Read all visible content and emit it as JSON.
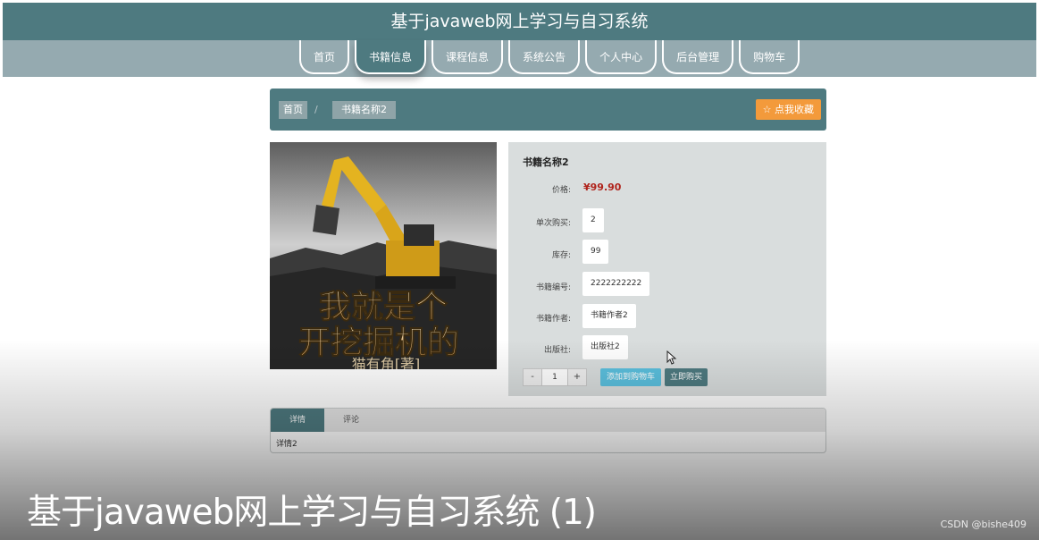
{
  "site_title": "基于javaweb网上学习与自习系统",
  "nav": {
    "items": [
      "首页",
      "书籍信息",
      "课程信息",
      "系统公告",
      "个人中心",
      "后台管理",
      "购物车"
    ],
    "active_index": 1
  },
  "breadcrumb": {
    "home": "首页",
    "separator": "/",
    "current": "书籍名称2"
  },
  "favorite_button": "☆ 点我收藏",
  "cover": {
    "title_line1": "我就是个",
    "title_line2": "开挖掘机的",
    "author_line": "猫有角[著]"
  },
  "book": {
    "name": "书籍名称2",
    "price_label": "价格:",
    "price": "¥99.90",
    "fields": [
      {
        "label": "单次购买:",
        "value": "2"
      },
      {
        "label": "库存:",
        "value": "99"
      },
      {
        "label": "书籍编号:",
        "value": "2222222222"
      },
      {
        "label": "书籍作者:",
        "value": "书籍作者2"
      },
      {
        "label": "出版社:",
        "value": "出版社2"
      }
    ]
  },
  "quantity": {
    "minus": "-",
    "value": "1",
    "plus": "+"
  },
  "add_to_cart": "添加到购物车",
  "buy_now": "立即购买",
  "tabs": {
    "items": [
      "详情",
      "评论"
    ],
    "active_index": 0,
    "content": "详情2"
  },
  "video_caption": "基于javaweb网上学习与自习系统 (1)",
  "watermark": "CSDN @bishe409",
  "colors": {
    "primary": "#4e7a80",
    "nav_bg": "#95aab0",
    "favorite": "#f39a3b",
    "add_cart": "#5bc0de",
    "price": "#b0241c"
  }
}
